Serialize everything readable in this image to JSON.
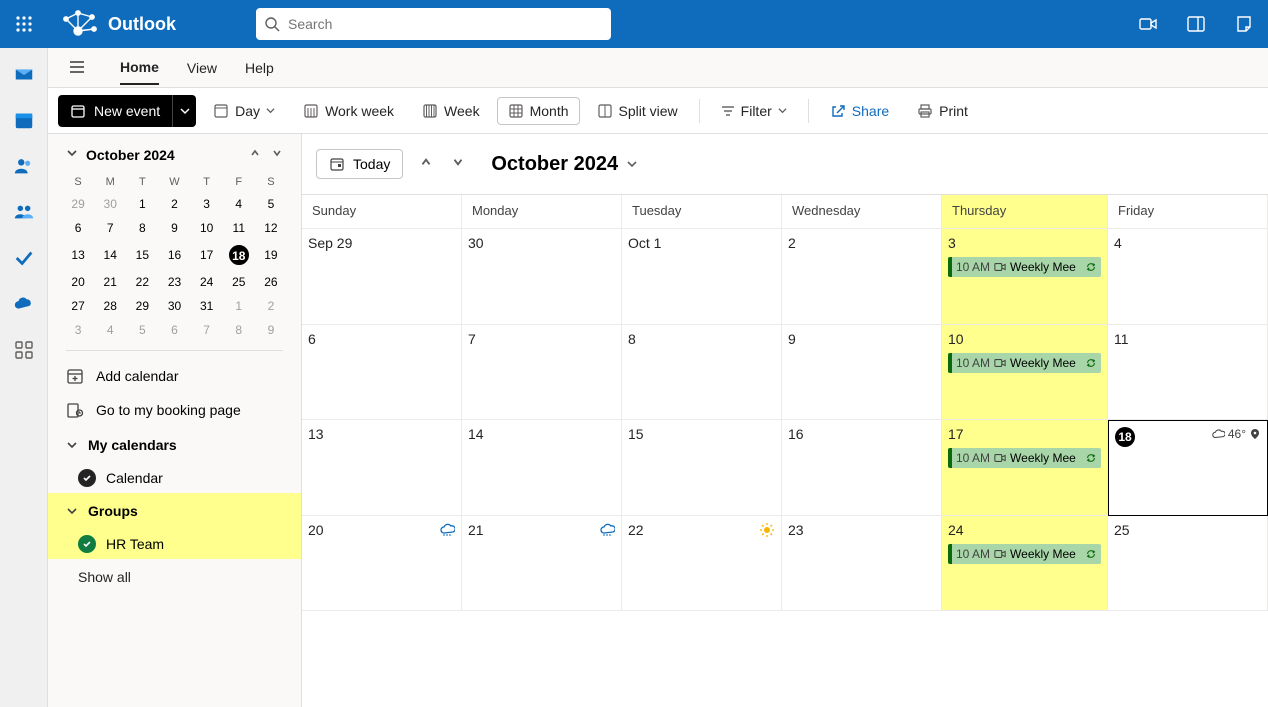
{
  "app_name": "Outlook",
  "search": {
    "placeholder": "Search"
  },
  "menubar": {
    "home": "Home",
    "view": "View",
    "help": "Help"
  },
  "ribbon": {
    "new_event": "New event",
    "day": "Day",
    "work_week": "Work week",
    "week": "Week",
    "month": "Month",
    "split": "Split view",
    "filter": "Filter",
    "share": "Share",
    "print": "Print"
  },
  "mini_calendar": {
    "label": "October 2024",
    "dow": [
      "S",
      "M",
      "T",
      "W",
      "T",
      "F",
      "S"
    ],
    "rows": [
      [
        {
          "n": "29",
          "d": 1
        },
        {
          "n": "30",
          "d": 1
        },
        {
          "n": "1"
        },
        {
          "n": "2"
        },
        {
          "n": "3"
        },
        {
          "n": "4"
        },
        {
          "n": "5"
        }
      ],
      [
        {
          "n": "6"
        },
        {
          "n": "7"
        },
        {
          "n": "8"
        },
        {
          "n": "9"
        },
        {
          "n": "10"
        },
        {
          "n": "11"
        },
        {
          "n": "12"
        }
      ],
      [
        {
          "n": "13"
        },
        {
          "n": "14"
        },
        {
          "n": "15"
        },
        {
          "n": "16"
        },
        {
          "n": "17"
        },
        {
          "n": "18",
          "t": 1
        },
        {
          "n": "19"
        }
      ],
      [
        {
          "n": "20"
        },
        {
          "n": "21"
        },
        {
          "n": "22"
        },
        {
          "n": "23"
        },
        {
          "n": "24"
        },
        {
          "n": "25"
        },
        {
          "n": "26"
        }
      ],
      [
        {
          "n": "27"
        },
        {
          "n": "28"
        },
        {
          "n": "29"
        },
        {
          "n": "30"
        },
        {
          "n": "31"
        },
        {
          "n": "1",
          "d": 1
        },
        {
          "n": "2",
          "d": 1
        }
      ],
      [
        {
          "n": "3",
          "d": 1
        },
        {
          "n": "4",
          "d": 1
        },
        {
          "n": "5",
          "d": 1
        },
        {
          "n": "6",
          "d": 1
        },
        {
          "n": "7",
          "d": 1
        },
        {
          "n": "8",
          "d": 1
        },
        {
          "n": "9",
          "d": 1
        }
      ]
    ]
  },
  "sidebar": {
    "add_calendar": "Add calendar",
    "booking": "Go to my booking page",
    "my_calendars": "My calendars",
    "calendar": "Calendar",
    "groups": "Groups",
    "hr_team": "HR Team",
    "show_all": "Show all"
  },
  "calendar": {
    "today_btn": "Today",
    "title": "October 2024",
    "day_headers": [
      "Sunday",
      "Monday",
      "Tuesday",
      "Wednesday",
      "Thursday",
      "Friday"
    ],
    "weather_today": "46°",
    "event": {
      "time": "10 AM",
      "title": "Weekly Mee"
    },
    "weeks": [
      [
        "Sep 29",
        "30",
        "Oct 1",
        "2",
        "3",
        "4"
      ],
      [
        "6",
        "7",
        "8",
        "9",
        "10",
        "11"
      ],
      [
        "13",
        "14",
        "15",
        "16",
        "17",
        "18"
      ],
      [
        "20",
        "21",
        "22",
        "23",
        "24",
        "25"
      ]
    ]
  }
}
